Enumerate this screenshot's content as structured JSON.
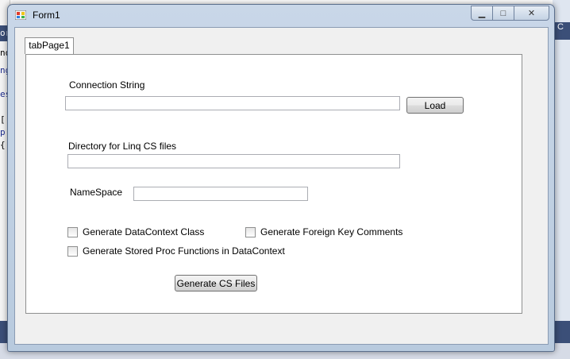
{
  "window": {
    "title": "Form1"
  },
  "controls": {
    "minimize": "▁",
    "maximize": "□",
    "close": "✕"
  },
  "tab": {
    "label": "tabPage1"
  },
  "form": {
    "connection_label": "Connection String",
    "connection_value": "",
    "load_button": "Load",
    "directory_label": "Directory for Linq CS files",
    "directory_value": "",
    "namespace_label": "NameSpace",
    "namespace_value": "",
    "chk_datacontext": "Generate DataContext Class",
    "chk_foreign_key": "Generate Foreign Key Comments",
    "chk_stored_proc": "Generate Stored Proc Functions in DataContext",
    "generate_button": "Generate CS Files"
  },
  "background": {
    "left_fragments": [
      "or",
      "nq",
      "ng",
      "es",
      "[",
      "p",
      "{"
    ],
    "right_fragment": "C"
  }
}
